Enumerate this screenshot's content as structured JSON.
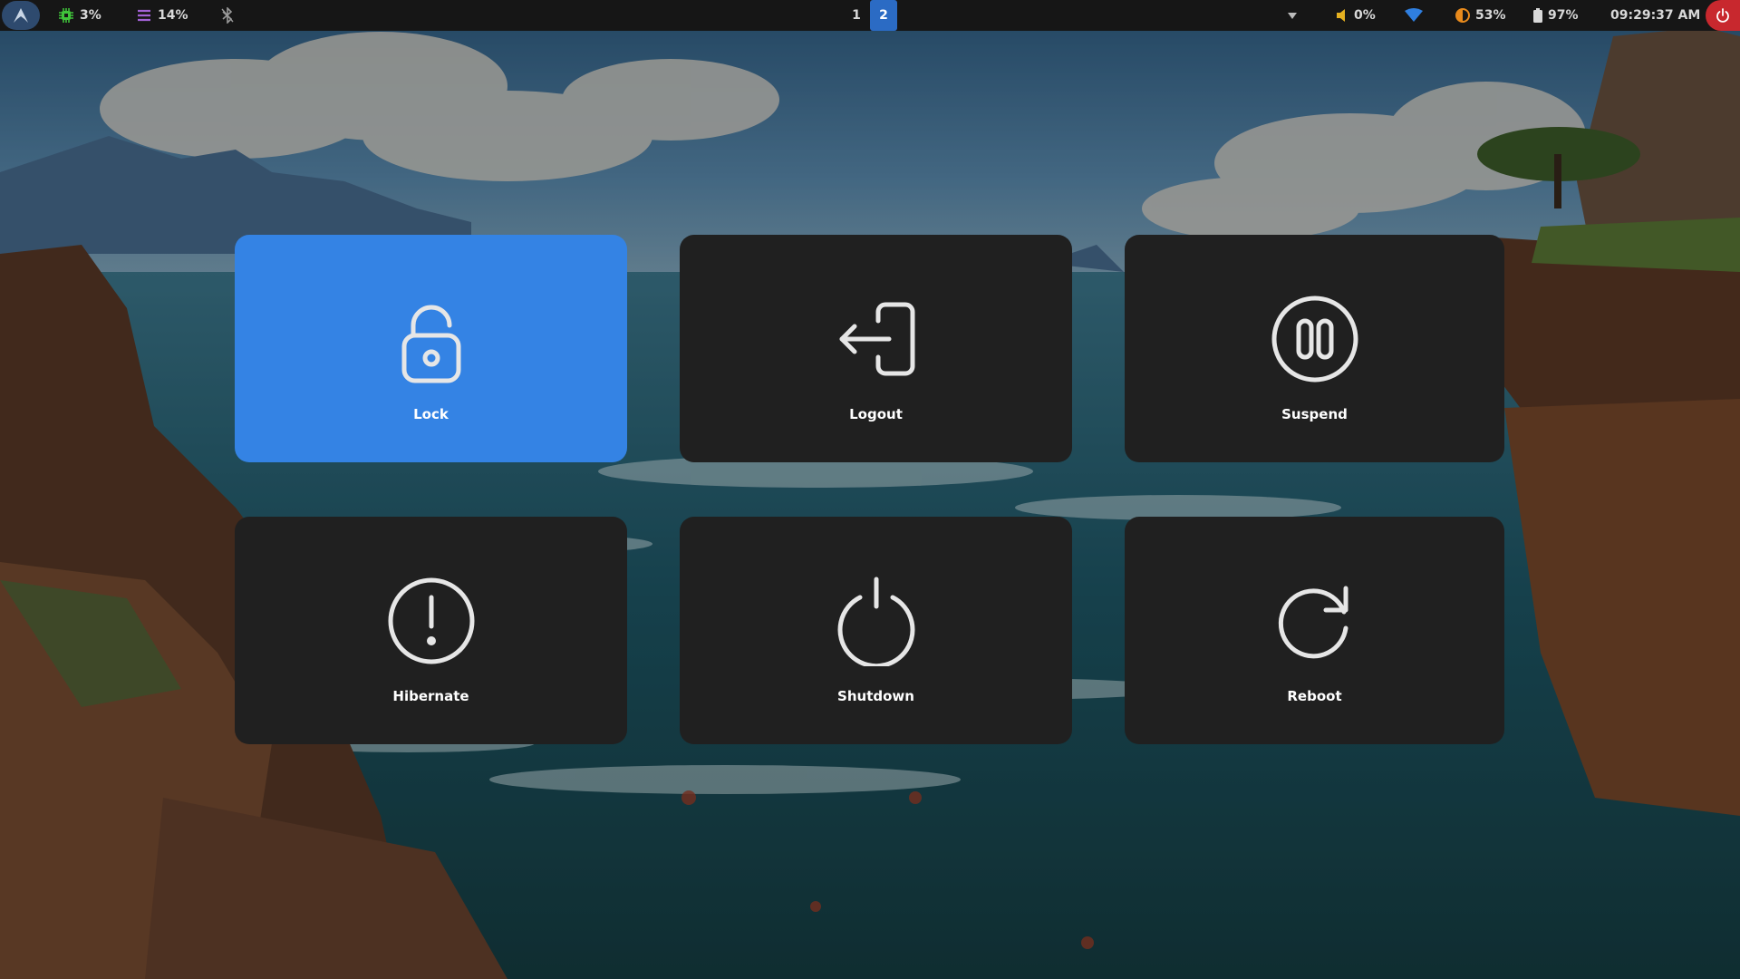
{
  "topbar": {
    "launcher_icon": "arch-icon",
    "cpu": {
      "icon": "cpu-icon",
      "value": "3%",
      "color": "#3fc23a"
    },
    "memory": {
      "icon": "memory-icon",
      "value": "14%",
      "color": "#a262d6"
    },
    "bluetooth": {
      "icon": "bluetooth-icon"
    },
    "workspaces": [
      {
        "label": "1",
        "active": false
      },
      {
        "label": "2",
        "active": true
      }
    ],
    "tray": {
      "overflow_icon": "chevron-down-icon",
      "volume": {
        "icon": "volume-icon",
        "value": "0%",
        "color": "#e4b020"
      },
      "wifi": {
        "icon": "wifi-icon",
        "color": "#2f7fe0"
      },
      "brightness": {
        "icon": "brightness-icon",
        "value": "53%",
        "color": "#e88a1c"
      },
      "battery": {
        "icon": "battery-icon",
        "value": "97%"
      },
      "clock": "09:29:37 AM",
      "power_icon": "power-icon",
      "power_color": "#c8282e"
    }
  },
  "power_menu": {
    "selected_index": 0,
    "accent_color": "#3483e4",
    "items": [
      {
        "label": "Lock",
        "icon": "lock-icon"
      },
      {
        "label": "Logout",
        "icon": "logout-icon"
      },
      {
        "label": "Suspend",
        "icon": "suspend-icon"
      },
      {
        "label": "Hibernate",
        "icon": "hibernate-icon"
      },
      {
        "label": "Shutdown",
        "icon": "shutdown-icon"
      },
      {
        "label": "Reboot",
        "icon": "reboot-icon"
      }
    ]
  }
}
